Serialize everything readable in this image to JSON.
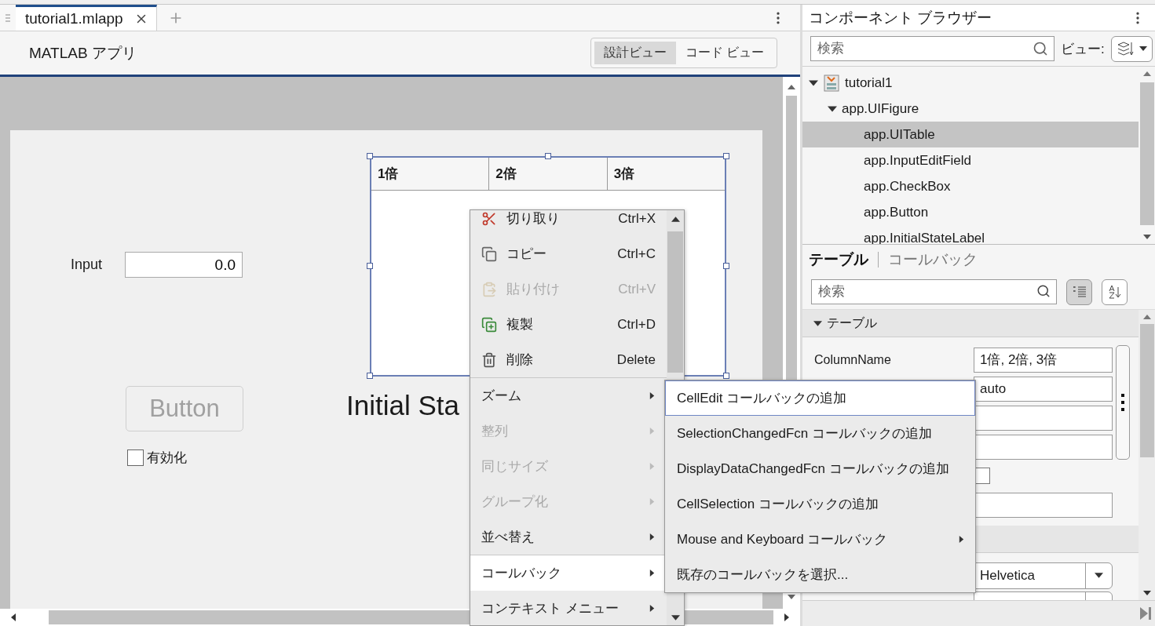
{
  "editor_tabs": [
    {
      "label": "tutorial1.mlapp",
      "selected": true
    }
  ],
  "app_title": "MATLAB アプリ",
  "view_toggle": [
    {
      "label": "設計ビュー",
      "selected": true
    },
    {
      "label": "コード ビュー",
      "selected": false
    }
  ],
  "canvas": {
    "input_label": "Input",
    "input_value": "0.0",
    "button": {
      "label": "Button",
      "disabled": true
    },
    "checkbox": {
      "label": "有効化",
      "checked": false
    },
    "table": {
      "columns": [
        "1倍",
        "2倍",
        "3倍"
      ],
      "selected": true
    },
    "status_label": "Initial Sta"
  },
  "context_menu": {
    "groups": [
      [
        {
          "kind": "command",
          "label": "切り取り",
          "shortcut": "Ctrl+X",
          "disabled": false,
          "selected": false
        },
        {
          "kind": "command",
          "label": "コピー",
          "shortcut": "Ctrl+C",
          "disabled": false,
          "selected": false
        },
        {
          "kind": "command",
          "label": "貼り付け",
          "shortcut": "Ctrl+V",
          "disabled": true,
          "selected": false
        },
        {
          "kind": "command",
          "label": "複製",
          "shortcut": "Ctrl+D",
          "disabled": false,
          "selected": false
        },
        {
          "kind": "command",
          "label": "削除",
          "shortcut": "Delete",
          "disabled": false,
          "selected": false
        }
      ],
      [
        {
          "kind": "submenu",
          "label": "ズーム",
          "disabled": false,
          "selected": false
        },
        {
          "kind": "submenu",
          "label": "整列",
          "disabled": true,
          "selected": false
        },
        {
          "kind": "submenu",
          "label": "同じサイズ",
          "disabled": true,
          "selected": false
        },
        {
          "kind": "submenu",
          "label": "グループ化",
          "disabled": true,
          "selected": false
        },
        {
          "kind": "submenu",
          "label": "並べ替え",
          "disabled": false,
          "selected": false
        }
      ],
      [
        {
          "kind": "submenu",
          "label": "コールバック",
          "disabled": false,
          "selected": true
        },
        {
          "kind": "submenu",
          "label": "コンテキスト メニュー",
          "disabled": false,
          "selected": false
        }
      ]
    ]
  },
  "submenu": {
    "items": [
      {
        "kind": "command",
        "label": "CellEdit コールバックの追加",
        "selected": true
      },
      {
        "kind": "command",
        "label": "SelectionChangedFcn コールバックの追加",
        "selected": false
      },
      {
        "kind": "command",
        "label": "DisplayDataChangedFcn コールバックの追加",
        "selected": false
      },
      {
        "kind": "command",
        "label": "CellSelection コールバックの追加",
        "selected": false
      },
      {
        "kind": "submenu",
        "label": "Mouse and Keyboard コールバック",
        "selected": false
      },
      {
        "kind": "command",
        "label": "既存のコールバックを選択...",
        "selected": false
      }
    ]
  },
  "component_browser": {
    "title": "コンポーネント ブラウザー",
    "search_placeholder": "検索",
    "view_label": "ビュー:",
    "tree": [
      {
        "label": "tutorial1",
        "expanded": true,
        "selected": false,
        "children": [
          {
            "label": "app.UIFigure",
            "expanded": true,
            "selected": false,
            "children": [
              {
                "label": "app.UITable",
                "selected": true
              },
              {
                "label": "app.InputEditField",
                "selected": false
              },
              {
                "label": "app.CheckBox",
                "selected": false
              },
              {
                "label": "app.Button",
                "selected": false
              },
              {
                "label": "app.InitialStateLabel",
                "selected": false
              }
            ]
          }
        ]
      }
    ]
  },
  "inspector": {
    "tabs": [
      {
        "label": "テーブル",
        "selected": true
      },
      {
        "label": "コールバック",
        "selected": false
      }
    ],
    "search_placeholder": "検索",
    "view_buttons": [
      {
        "selected": true
      },
      {
        "selected": false
      }
    ],
    "sections": [
      {
        "title": "テーブル",
        "expanded": true,
        "rows": [
          {
            "kind": "text",
            "label": "ColumnName",
            "value": "1倍, 2倍, 3倍"
          },
          {
            "kind": "text",
            "value": "auto"
          },
          {
            "kind": "text"
          },
          {
            "kind": "text"
          },
          {
            "kind": "checkbox",
            "checked": false
          },
          {
            "kind": "text"
          }
        ]
      },
      {
        "rows": [
          {
            "kind": "dropdown",
            "value": "Helvetica"
          },
          {
            "kind": "dropdown"
          }
        ]
      }
    ]
  }
}
